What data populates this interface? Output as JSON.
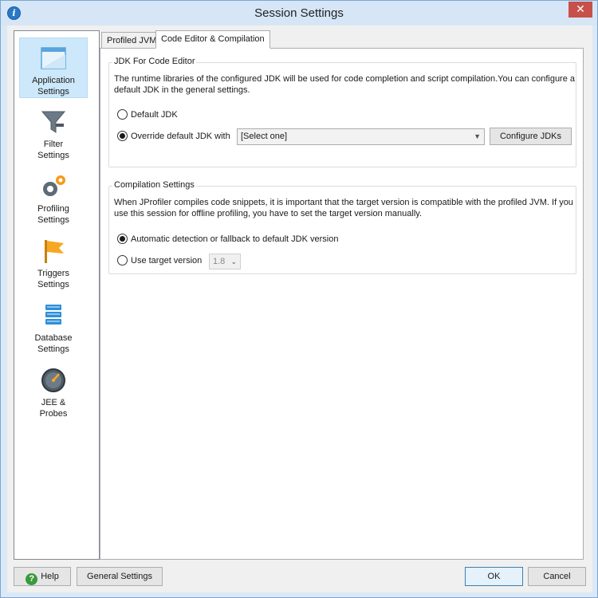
{
  "window": {
    "title": "Session Settings",
    "close_glyph": "✕"
  },
  "sidebar": {
    "items": [
      {
        "label_1": "Application",
        "label_2": "Settings",
        "icon": "application-window-icon",
        "selected": true
      },
      {
        "label_1": "Filter",
        "label_2": "Settings",
        "icon": "filter-funnel-icon",
        "selected": false
      },
      {
        "label_1": "Profiling",
        "label_2": "Settings",
        "icon": "gears-icon",
        "selected": false
      },
      {
        "label_1": "Triggers",
        "label_2": "Settings",
        "icon": "flag-icon",
        "selected": false
      },
      {
        "label_1": "Database",
        "label_2": "Settings",
        "icon": "database-icon",
        "selected": false
      },
      {
        "label_1": "JEE &",
        "label_2": "Probes",
        "icon": "gauge-icon",
        "selected": false
      }
    ]
  },
  "tabs": [
    {
      "label": "Profiled JVM",
      "active": false
    },
    {
      "label": "Code Editor & Compilation",
      "active": true
    }
  ],
  "jdk_group": {
    "title": "JDK For Code Editor",
    "desc_line1": "The runtime libraries of the configured JDK will be used for code completion and script compilation.You can configure a",
    "desc_line2": "default JDK in the general settings.",
    "option_default": "Default JDK",
    "option_override": "Override default JDK with",
    "selected_option": "override",
    "select_value": "[Select one]",
    "configure_button": "Configure JDKs"
  },
  "compile_group": {
    "title": "Compilation Settings",
    "desc_line1": "When JProfiler compiles code snippets, it is important that the target version is compatible with the profiled JVM. If you",
    "desc_line2": "use this session for offline profiling, you have to set the target version manually.",
    "option_auto": "Automatic detection or fallback to default JDK version",
    "option_target": "Use target version",
    "selected_option": "auto",
    "target_value": "1.8"
  },
  "footer": {
    "help_button": "Help",
    "general_button": "General Settings",
    "ok_button": "OK",
    "cancel_button": "Cancel"
  },
  "colors": {
    "accent": "#2a78c8",
    "selection": "#cde8fb"
  }
}
